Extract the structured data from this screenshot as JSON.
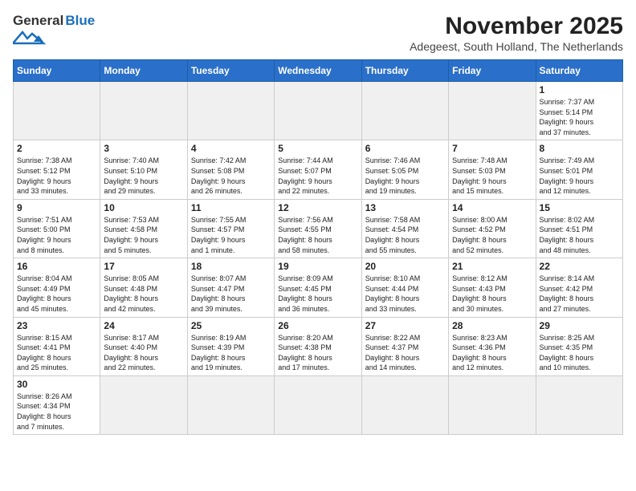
{
  "header": {
    "logo_general": "General",
    "logo_blue": "Blue",
    "main_title": "November 2025",
    "subtitle": "Adegeest, South Holland, The Netherlands"
  },
  "columns": [
    "Sunday",
    "Monday",
    "Tuesday",
    "Wednesday",
    "Thursday",
    "Friday",
    "Saturday"
  ],
  "weeks": [
    {
      "days": [
        {
          "num": "",
          "info": "",
          "empty": true
        },
        {
          "num": "",
          "info": "",
          "empty": true
        },
        {
          "num": "",
          "info": "",
          "empty": true
        },
        {
          "num": "",
          "info": "",
          "empty": true
        },
        {
          "num": "",
          "info": "",
          "empty": true
        },
        {
          "num": "",
          "info": "",
          "empty": true
        },
        {
          "num": "1",
          "info": "Sunrise: 7:37 AM\nSunset: 5:14 PM\nDaylight: 9 hours\nand 37 minutes."
        }
      ]
    },
    {
      "days": [
        {
          "num": "2",
          "info": "Sunrise: 7:38 AM\nSunset: 5:12 PM\nDaylight: 9 hours\nand 33 minutes."
        },
        {
          "num": "3",
          "info": "Sunrise: 7:40 AM\nSunset: 5:10 PM\nDaylight: 9 hours\nand 29 minutes."
        },
        {
          "num": "4",
          "info": "Sunrise: 7:42 AM\nSunset: 5:08 PM\nDaylight: 9 hours\nand 26 minutes."
        },
        {
          "num": "5",
          "info": "Sunrise: 7:44 AM\nSunset: 5:07 PM\nDaylight: 9 hours\nand 22 minutes."
        },
        {
          "num": "6",
          "info": "Sunrise: 7:46 AM\nSunset: 5:05 PM\nDaylight: 9 hours\nand 19 minutes."
        },
        {
          "num": "7",
          "info": "Sunrise: 7:48 AM\nSunset: 5:03 PM\nDaylight: 9 hours\nand 15 minutes."
        },
        {
          "num": "8",
          "info": "Sunrise: 7:49 AM\nSunset: 5:01 PM\nDaylight: 9 hours\nand 12 minutes."
        }
      ]
    },
    {
      "days": [
        {
          "num": "9",
          "info": "Sunrise: 7:51 AM\nSunset: 5:00 PM\nDaylight: 9 hours\nand 8 minutes."
        },
        {
          "num": "10",
          "info": "Sunrise: 7:53 AM\nSunset: 4:58 PM\nDaylight: 9 hours\nand 5 minutes."
        },
        {
          "num": "11",
          "info": "Sunrise: 7:55 AM\nSunset: 4:57 PM\nDaylight: 9 hours\nand 1 minute."
        },
        {
          "num": "12",
          "info": "Sunrise: 7:56 AM\nSunset: 4:55 PM\nDaylight: 8 hours\nand 58 minutes."
        },
        {
          "num": "13",
          "info": "Sunrise: 7:58 AM\nSunset: 4:54 PM\nDaylight: 8 hours\nand 55 minutes."
        },
        {
          "num": "14",
          "info": "Sunrise: 8:00 AM\nSunset: 4:52 PM\nDaylight: 8 hours\nand 52 minutes."
        },
        {
          "num": "15",
          "info": "Sunrise: 8:02 AM\nSunset: 4:51 PM\nDaylight: 8 hours\nand 48 minutes."
        }
      ]
    },
    {
      "days": [
        {
          "num": "16",
          "info": "Sunrise: 8:04 AM\nSunset: 4:49 PM\nDaylight: 8 hours\nand 45 minutes."
        },
        {
          "num": "17",
          "info": "Sunrise: 8:05 AM\nSunset: 4:48 PM\nDaylight: 8 hours\nand 42 minutes."
        },
        {
          "num": "18",
          "info": "Sunrise: 8:07 AM\nSunset: 4:47 PM\nDaylight: 8 hours\nand 39 minutes."
        },
        {
          "num": "19",
          "info": "Sunrise: 8:09 AM\nSunset: 4:45 PM\nDaylight: 8 hours\nand 36 minutes."
        },
        {
          "num": "20",
          "info": "Sunrise: 8:10 AM\nSunset: 4:44 PM\nDaylight: 8 hours\nand 33 minutes."
        },
        {
          "num": "21",
          "info": "Sunrise: 8:12 AM\nSunset: 4:43 PM\nDaylight: 8 hours\nand 30 minutes."
        },
        {
          "num": "22",
          "info": "Sunrise: 8:14 AM\nSunset: 4:42 PM\nDaylight: 8 hours\nand 27 minutes."
        }
      ]
    },
    {
      "days": [
        {
          "num": "23",
          "info": "Sunrise: 8:15 AM\nSunset: 4:41 PM\nDaylight: 8 hours\nand 25 minutes."
        },
        {
          "num": "24",
          "info": "Sunrise: 8:17 AM\nSunset: 4:40 PM\nDaylight: 8 hours\nand 22 minutes."
        },
        {
          "num": "25",
          "info": "Sunrise: 8:19 AM\nSunset: 4:39 PM\nDaylight: 8 hours\nand 19 minutes."
        },
        {
          "num": "26",
          "info": "Sunrise: 8:20 AM\nSunset: 4:38 PM\nDaylight: 8 hours\nand 17 minutes."
        },
        {
          "num": "27",
          "info": "Sunrise: 8:22 AM\nSunset: 4:37 PM\nDaylight: 8 hours\nand 14 minutes."
        },
        {
          "num": "28",
          "info": "Sunrise: 8:23 AM\nSunset: 4:36 PM\nDaylight: 8 hours\nand 12 minutes."
        },
        {
          "num": "29",
          "info": "Sunrise: 8:25 AM\nSunset: 4:35 PM\nDaylight: 8 hours\nand 10 minutes."
        }
      ]
    },
    {
      "days": [
        {
          "num": "30",
          "info": "Sunrise: 8:26 AM\nSunset: 4:34 PM\nDaylight: 8 hours\nand 7 minutes."
        },
        {
          "num": "",
          "info": "",
          "empty": true
        },
        {
          "num": "",
          "info": "",
          "empty": true
        },
        {
          "num": "",
          "info": "",
          "empty": true
        },
        {
          "num": "",
          "info": "",
          "empty": true
        },
        {
          "num": "",
          "info": "",
          "empty": true
        },
        {
          "num": "",
          "info": "",
          "empty": true
        }
      ]
    }
  ]
}
